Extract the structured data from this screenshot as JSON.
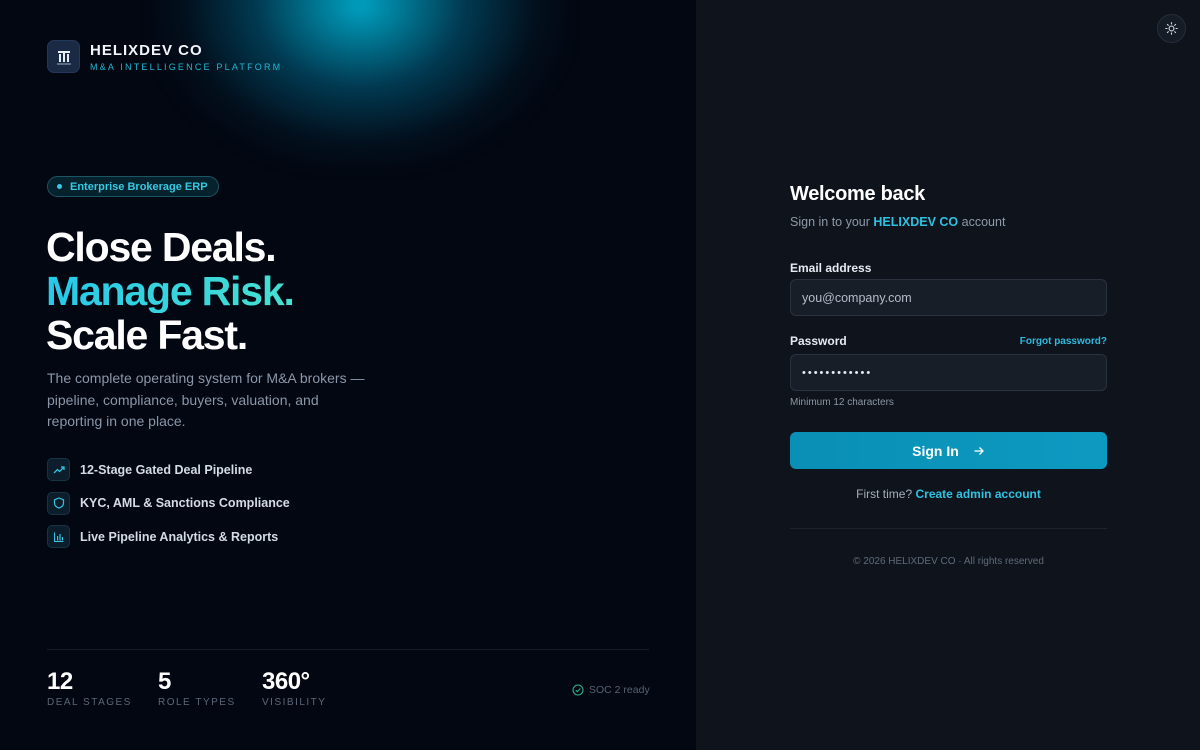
{
  "brand": {
    "name": "HELIXDEV CO",
    "tagline": "M&A INTELLIGENCE PLATFORM"
  },
  "hero": {
    "pill": "Enterprise Brokerage ERP",
    "line1": "Close Deals.",
    "line2": "Manage Risk.",
    "line3": "Scale Fast.",
    "lede": "The complete operating system for M&A brokers — pipeline, compliance, buyers, valuation, and reporting in one place."
  },
  "features": [
    {
      "label": "12-Stage Gated Deal Pipeline",
      "icon": "trending-up-icon"
    },
    {
      "label": "KYC, AML & Sanctions Compliance",
      "icon": "shield-icon"
    },
    {
      "label": "Live Pipeline Analytics & Reports",
      "icon": "bar-chart-icon"
    }
  ],
  "stats": [
    {
      "value": "12",
      "label": "DEAL STAGES"
    },
    {
      "value": "5",
      "label": "ROLE TYPES"
    },
    {
      "value": "360°",
      "label": "VISIBILITY"
    }
  ],
  "soc": "SOC 2 ready",
  "form": {
    "title": "Welcome back",
    "subtitle_prefix": "Sign in to your",
    "subtitle_account": "HELIXDEV CO",
    "subtitle_suffix": "account",
    "email_label": "Email address",
    "email_placeholder": "you@company.com",
    "password_label": "Password",
    "forgot": "Forgot password?",
    "password_value": "••••••••••••",
    "password_hint": "Minimum 12 characters",
    "submit": "Sign In",
    "first_time": "First time?",
    "create": "Create admin account",
    "copyright": "© 2026 HELIXDEV CO · All rights reserved"
  },
  "colors": {
    "accent": "#2fc1e0",
    "button": "#0d9ac1",
    "left_bg": "#030711",
    "right_bg": "#0f141c"
  }
}
